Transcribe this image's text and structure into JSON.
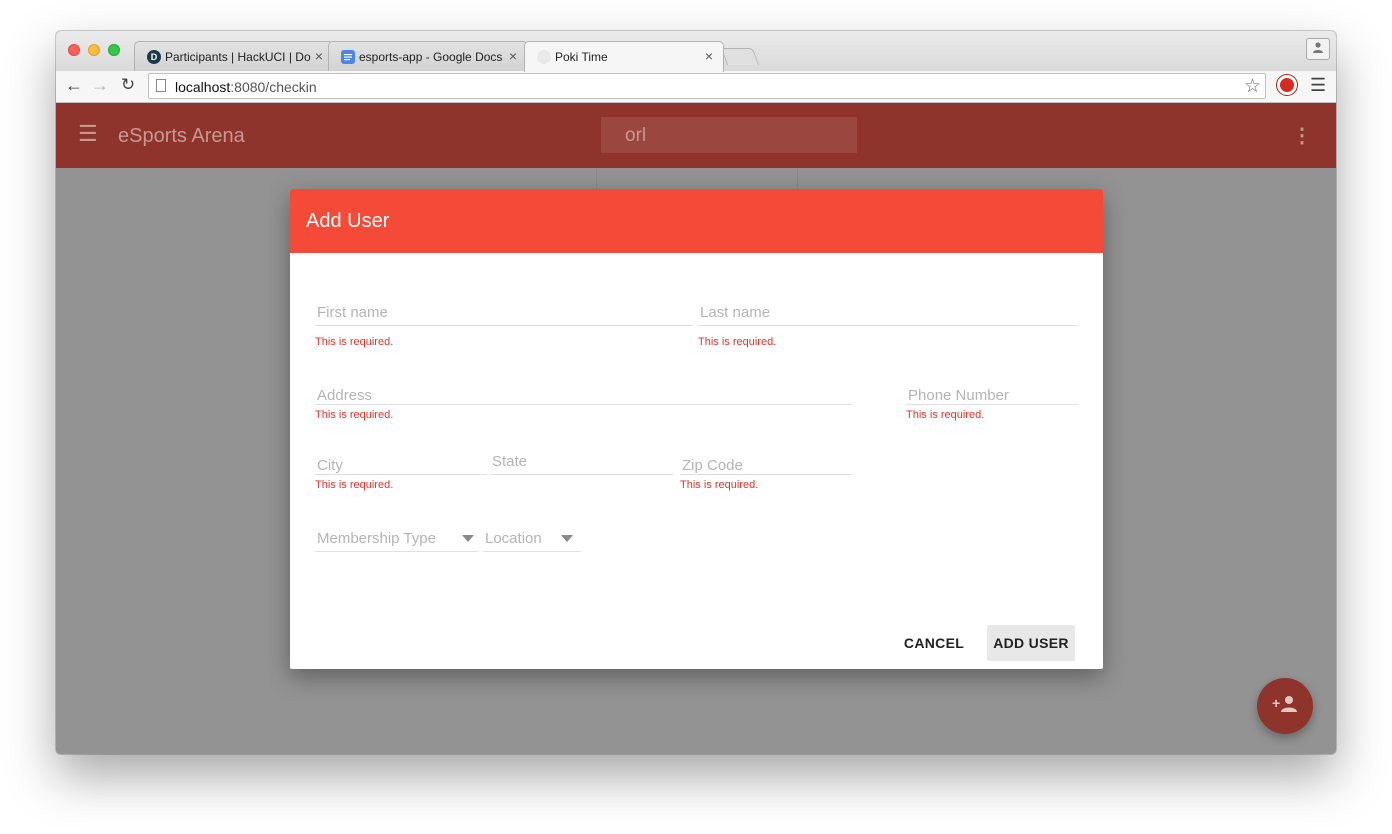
{
  "browser": {
    "tabs": [
      {
        "title": "Participants | HackUCI | Do",
        "icon": "d-badge-icon",
        "active": false
      },
      {
        "title": "esports-app - Google Docs",
        "icon": "google-docs-icon",
        "active": false
      },
      {
        "title": "Poki Time",
        "icon": "page-icon",
        "active": true
      }
    ],
    "tab_close": "×",
    "url_host": "localhost",
    "url_path": ":8080/checkin"
  },
  "app": {
    "title": "eSports Arena",
    "search_value": "orl",
    "accent_color": "#f44a37",
    "appbar_color": "#8e342c"
  },
  "dialog": {
    "title": "Add User",
    "fields": {
      "first_name": {
        "placeholder": "First name",
        "error": "This is required."
      },
      "last_name": {
        "placeholder": "Last name",
        "error": "This is required."
      },
      "address": {
        "placeholder": "Address",
        "error": "This is required."
      },
      "phone": {
        "placeholder": "Phone Number",
        "error": "This is required."
      },
      "city": {
        "placeholder": "City",
        "error": "This is required."
      },
      "state": {
        "placeholder": "State"
      },
      "zip": {
        "placeholder": "Zip Code",
        "error": "This is required."
      },
      "membership": {
        "placeholder": "Membership Type"
      },
      "location": {
        "placeholder": "Location"
      }
    },
    "buttons": {
      "cancel": "CANCEL",
      "add": "ADD USER"
    }
  }
}
